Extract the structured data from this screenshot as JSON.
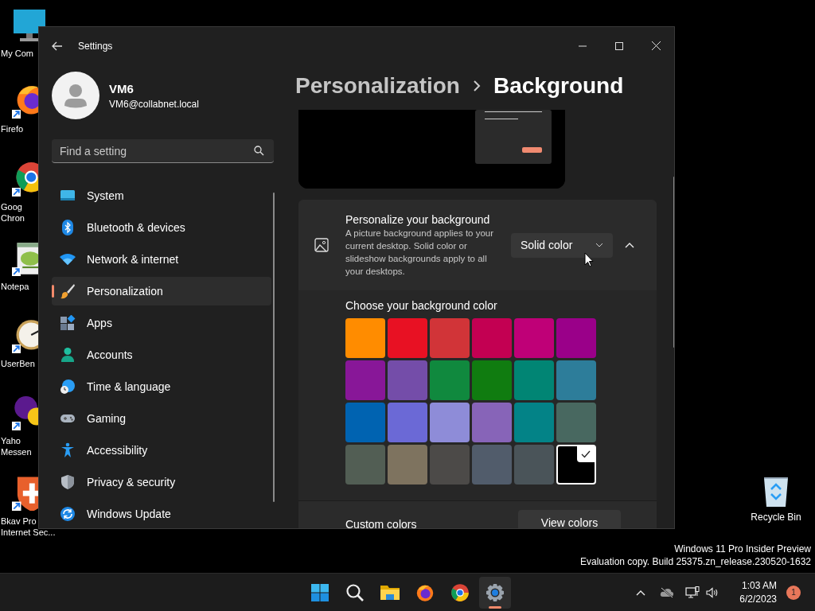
{
  "desktop": {
    "icons": [
      {
        "kind": "computer",
        "lines": [
          "My Com"
        ]
      },
      {
        "kind": "firefox",
        "lines": [
          "Firefo"
        ]
      },
      {
        "kind": "chrome",
        "lines": [
          "Goog",
          "Chron"
        ]
      },
      {
        "kind": "notepad",
        "lines": [
          "Notepa"
        ]
      },
      {
        "kind": "gauge",
        "lines": [
          "UserBen"
        ]
      },
      {
        "kind": "messenger",
        "lines": [
          "Yaho",
          "Messen"
        ]
      },
      {
        "kind": "shield",
        "lines": [
          "Bkav Pro",
          "Internet Sec..."
        ]
      }
    ],
    "recycle_bin": {
      "label": "Recycle Bin"
    },
    "watermark": [
      "Windows 11 Pro Insider Preview",
      "Evaluation copy. Build 25375.zn_release.230520-1632"
    ]
  },
  "window": {
    "title": "Settings"
  },
  "profile": {
    "name": "VM6",
    "email": "VM6@collabnet.local"
  },
  "search": {
    "placeholder": "Find a setting"
  },
  "nav": [
    {
      "kind": "system",
      "label": "System",
      "selected": false
    },
    {
      "kind": "bluetooth",
      "label": "Bluetooth & devices",
      "selected": false
    },
    {
      "kind": "network",
      "label": "Network & internet",
      "selected": false
    },
    {
      "kind": "personalization",
      "label": "Personalization",
      "selected": true
    },
    {
      "kind": "apps",
      "label": "Apps",
      "selected": false
    },
    {
      "kind": "accounts",
      "label": "Accounts",
      "selected": false
    },
    {
      "kind": "time",
      "label": "Time & language",
      "selected": false
    },
    {
      "kind": "gaming",
      "label": "Gaming",
      "selected": false
    },
    {
      "kind": "accessibility",
      "label": "Accessibility",
      "selected": false
    },
    {
      "kind": "privacy",
      "label": "Privacy & security",
      "selected": false
    },
    {
      "kind": "update",
      "label": "Windows Update",
      "selected": false
    }
  ],
  "breadcrumb": {
    "parent": "Personalization",
    "current": "Background"
  },
  "background_card": {
    "title": "Personalize your background",
    "description": "A picture background applies to your current desktop. Solid color or slideshow backgrounds apply to all your desktops.",
    "dropdown": "Solid color",
    "expanded": true
  },
  "color_section": {
    "title": "Choose your background color",
    "swatches": [
      {
        "color": "#ff8c00",
        "selected": false
      },
      {
        "color": "#e81123",
        "selected": false
      },
      {
        "color": "#d13438",
        "selected": false
      },
      {
        "color": "#c30052",
        "selected": false
      },
      {
        "color": "#bf0077",
        "selected": false
      },
      {
        "color": "#9a0089",
        "selected": false
      },
      {
        "color": "#881798",
        "selected": false
      },
      {
        "color": "#744da9",
        "selected": false
      },
      {
        "color": "#10893e",
        "selected": false
      },
      {
        "color": "#107c10",
        "selected": false
      },
      {
        "color": "#018574",
        "selected": false
      },
      {
        "color": "#2d7d9a",
        "selected": false
      },
      {
        "color": "#0063b1",
        "selected": false
      },
      {
        "color": "#6b69d6",
        "selected": false
      },
      {
        "color": "#8e8cd8",
        "selected": false
      },
      {
        "color": "#8764b8",
        "selected": false
      },
      {
        "color": "#038387",
        "selected": false
      },
      {
        "color": "#486860",
        "selected": false
      },
      {
        "color": "#525e54",
        "selected": false
      },
      {
        "color": "#7e735f",
        "selected": false
      },
      {
        "color": "#4c4a48",
        "selected": false
      },
      {
        "color": "#515c6b",
        "selected": false
      },
      {
        "color": "#4a5459",
        "selected": false
      },
      {
        "color": "#000000",
        "selected": true
      }
    ]
  },
  "custom_colors": {
    "label": "Custom colors",
    "button": "View colors"
  },
  "taskbar": {
    "apps": [
      {
        "kind": "start",
        "selected": false
      },
      {
        "kind": "search",
        "selected": false
      },
      {
        "kind": "explorer",
        "selected": false
      },
      {
        "kind": "firefox",
        "selected": false
      },
      {
        "kind": "chrome",
        "selected": false
      },
      {
        "kind": "settings",
        "selected": true
      }
    ],
    "time": "1:03 AM",
    "date": "6/2/2023",
    "notifications": "1"
  }
}
